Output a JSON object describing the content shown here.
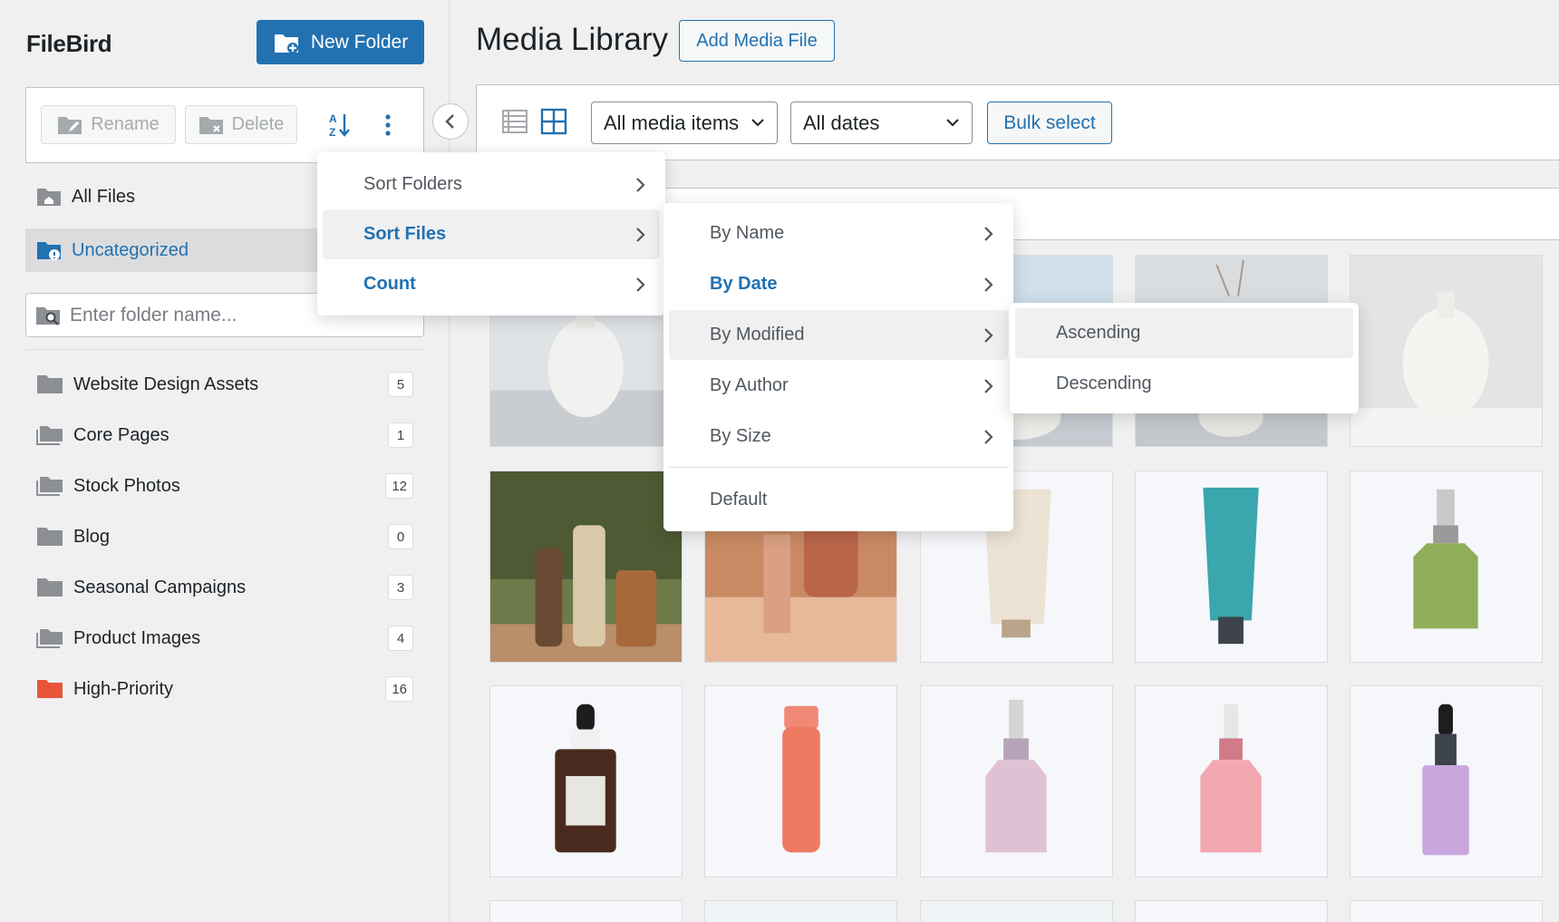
{
  "sidebar": {
    "brand": "FileBird",
    "new_folder_label": "New Folder",
    "rename_label": "Rename",
    "delete_label": "Delete",
    "nav": [
      {
        "label": "All Files"
      },
      {
        "label": "Uncategorized"
      }
    ],
    "search_placeholder": "Enter folder name...",
    "folders": [
      {
        "label": "Website Design Assets",
        "count": "5"
      },
      {
        "label": "Core Pages",
        "count": "1"
      },
      {
        "label": "Stock Photos",
        "count": "12"
      },
      {
        "label": "Blog",
        "count": "0"
      },
      {
        "label": "Seasonal Campaigns",
        "count": "3"
      },
      {
        "label": "Product Images",
        "count": "4"
      },
      {
        "label": "High-Priority",
        "count": "16"
      }
    ]
  },
  "main": {
    "title": "Media Library",
    "add_media_label": "Add Media File",
    "filter_media": "All media items",
    "filter_dates": "All dates",
    "bulk_select_label": "Bulk select"
  },
  "menus": {
    "level1": [
      {
        "label": "Sort Folders"
      },
      {
        "label": "Sort Files"
      },
      {
        "label": "Count"
      }
    ],
    "level2": [
      {
        "label": "By Name"
      },
      {
        "label": "By Date"
      },
      {
        "label": "By Modified"
      },
      {
        "label": "By Author"
      },
      {
        "label": "By Size"
      },
      {
        "label": "Default"
      }
    ],
    "level3": [
      {
        "label": "Ascending"
      },
      {
        "label": "Descending"
      }
    ]
  },
  "colors": {
    "accent": "#2271b1",
    "high_priority_folder": "#e9553b",
    "folder_gray": "#8c8f94"
  }
}
